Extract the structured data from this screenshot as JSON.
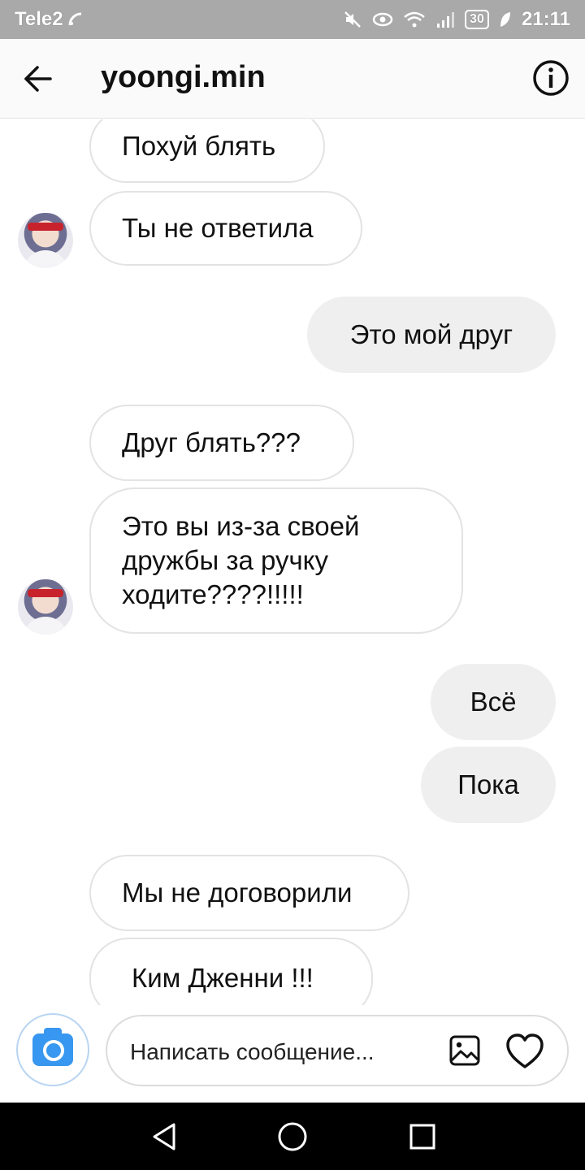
{
  "status_bar": {
    "carrier": "Tele2",
    "battery": "30",
    "time": "21:11",
    "icons": [
      "mute-icon",
      "eye-icon",
      "wifi-icon",
      "signal-icon",
      "battery-icon",
      "leaf-icon"
    ]
  },
  "header": {
    "title": "yoongi.min",
    "icons": [
      "back-arrow-icon",
      "info-icon"
    ]
  },
  "messages": [
    {
      "side": "in",
      "text": "Похуй блять"
    },
    {
      "side": "in",
      "text": "Ты не ответила"
    },
    {
      "side": "out",
      "text": "Это мой друг"
    },
    {
      "side": "in",
      "text": "Друг блять???"
    },
    {
      "side": "in",
      "text": "Это вы из-за своей дружбы за ручку ходите????!!!!!"
    },
    {
      "side": "out",
      "text": "Всё"
    },
    {
      "side": "out",
      "text": "Пока"
    },
    {
      "side": "in",
      "text": "Мы не договорили"
    },
    {
      "side": "in",
      "text": "Ким Дженни !!!"
    }
  ],
  "composer": {
    "placeholder": "Написать сообщение...",
    "icons": [
      "camera-icon",
      "gallery-icon",
      "heart-icon"
    ]
  },
  "nav_bar": {
    "icons": [
      "back-triangle-icon",
      "home-circle-icon",
      "recents-square-icon"
    ]
  },
  "colors": {
    "accent": "#3897f0",
    "outgoing_bubble": "#efefef",
    "incoming_border": "#e3e3e3",
    "status_bar": "#a9a9a9"
  }
}
